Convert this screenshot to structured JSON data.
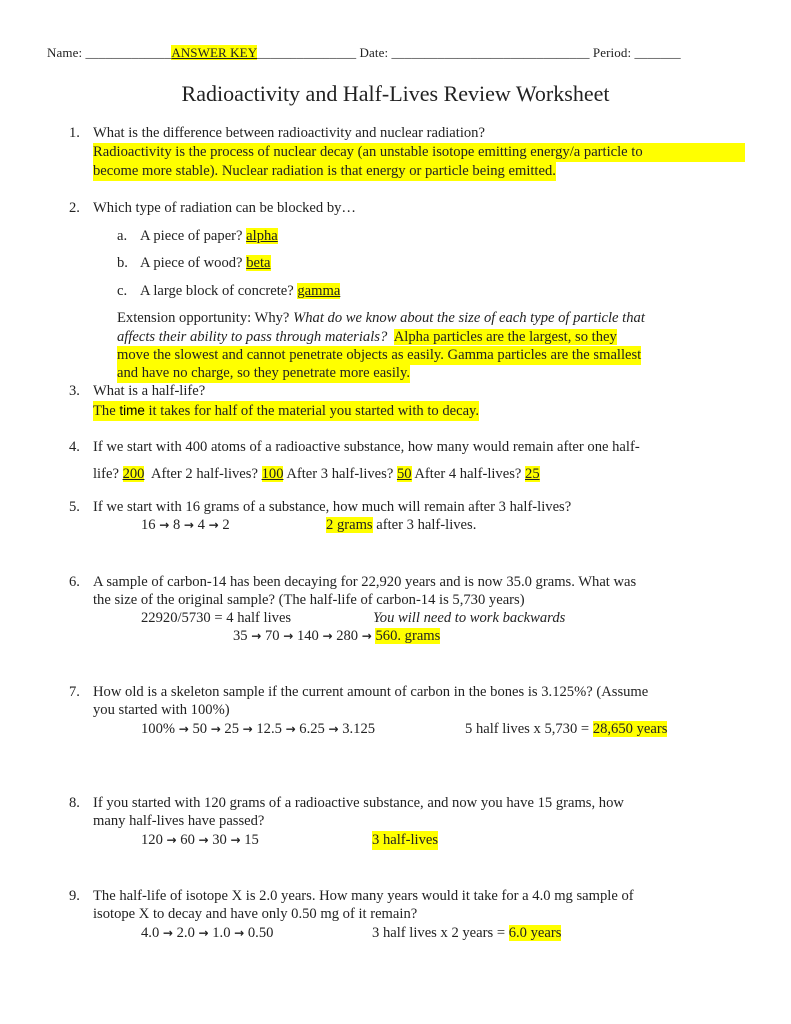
{
  "header": {
    "name_label": "Name: ",
    "name_blank_before": "_____________",
    "name_value": "ANSWER KEY",
    "name_blank_after": "_______________",
    "date_label": " Date: ",
    "date_blank": "______________________________",
    "period_label": " Period: ",
    "period_blank": "_______"
  },
  "title": "Radioactivity and Half-Lives Review Worksheet",
  "questions": [
    {
      "number": "1.",
      "text": "What is the difference between radioactivity and nuclear radiation?",
      "answer_lines": [
        "Radioactivity is the process of nuclear decay (an unstable isotope emitting energy/a particle to",
        "become more stable).  Nuclear radiation is that energy or particle being emitted."
      ]
    },
    {
      "number": "2.",
      "text": "Which type of radiation can be blocked by…",
      "parts": [
        {
          "letter": "a.",
          "text": "A piece of paper? ",
          "answer": "alpha"
        },
        {
          "letter": "b.",
          "text": "A piece of wood? ",
          "answer": "beta"
        },
        {
          "letter": "c.",
          "text": "A large block of concrete? ",
          "answer": "gamma"
        }
      ],
      "extension": {
        "label": "Extension opportunity: Why? ",
        "question_line1": "What do we know about the size of each type of particle that",
        "question_line2": "affects their ability to pass through materials?",
        "answer_line1": "Alpha particles are the largest, so they",
        "answer_line2": "move the slowest and cannot penetrate objects as easily.  Gamma particles are the smallest",
        "answer_line3": "and have no charge, so they penetrate more easily."
      }
    },
    {
      "number": "3.",
      "text": "What is a half-life?",
      "answer_pre": "The ",
      "answer_bold": "time",
      "answer_post": " it takes for half of the material you started with to decay."
    },
    {
      "number": "4.",
      "text_line1": "If we start with 400 atoms of a radioactive substance, how many would remain after one half-",
      "seg1": "life? ",
      "ans1": "200",
      "seg2": "  After 2 half-lives? ",
      "ans2": "100",
      "seg3": " After 3 half-lives? ",
      "ans3": "50",
      "seg4": " After 4 half-lives? ",
      "ans4": "25"
    },
    {
      "number": "5.",
      "text": "If we start with 16 grams of a substance, how much will remain after 3 half-lives?",
      "work": [
        "16",
        "8",
        "4",
        "2"
      ],
      "answer": "2 grams",
      "answer_post": " after 3 half-lives."
    },
    {
      "number": "6.",
      "text_line1": "A sample of carbon-14 has been decaying for 22,920 years and is now 35.0 grams.  What was",
      "text_line2": "the size of the original sample? (The half-life of carbon-14 is 5,730 years)",
      "calc": "22920/5730 = 4 half lives",
      "hint": "You will need to work backwards",
      "work": [
        "35",
        "70",
        "140",
        "280"
      ],
      "answer": "560. grams"
    },
    {
      "number": "7.",
      "text_line1": "How old is a skeleton sample if the current amount of carbon in the bones is 3.125%? (Assume",
      "text_line2": "you started with 100%)",
      "work": [
        "100%",
        "50",
        "25",
        "12.5",
        "6.25",
        "3.125"
      ],
      "calc": "5 half lives x 5,730 = ",
      "answer": "28,650 years"
    },
    {
      "number": "8.",
      "text_line1": "If you started with 120 grams of a radioactive substance, and now you have 15 grams, how",
      "text_line2": "many half-lives have passed?",
      "work": [
        "120",
        "60",
        "30",
        "15"
      ],
      "answer": "3 half-lives"
    },
    {
      "number": "9.",
      "text_line1": "The half-life of isotope X is 2.0 years.  How many years would it take for a 4.0 mg sample of",
      "text_line2": "isotope X to decay and have only 0.50 mg of it remain?",
      "work": [
        "4.0",
        "2.0",
        "1.0",
        "0.50"
      ],
      "calc": "3 half lives x 2 years = ",
      "answer": "6.0 years"
    }
  ],
  "icons": {
    "arrow": "→"
  }
}
